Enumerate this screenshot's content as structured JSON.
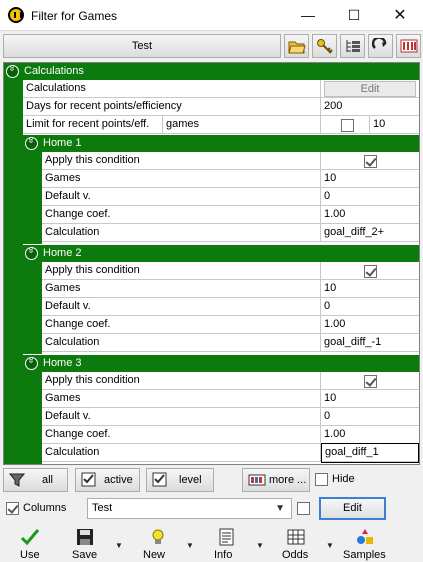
{
  "window": {
    "title": "Filter for Games",
    "minimize": "—",
    "maximize": "☐",
    "close": "✕"
  },
  "toolbar": {
    "preset_label": "Test"
  },
  "grid": {
    "root": {
      "label": "Calculations"
    },
    "rows": [
      {
        "label": "Calculations",
        "value": "Edit"
      },
      {
        "label": "Days for recent points/efficiency",
        "value": "200"
      },
      {
        "label": "Limit for recent points/eff.",
        "mid": "games",
        "value": "10"
      }
    ],
    "sections": [
      {
        "label": "Home 1",
        "apply_label": "Apply this condition",
        "fields": [
          {
            "label": "Games",
            "value": "10"
          },
          {
            "label": "Default v.",
            "value": "0"
          },
          {
            "label": "Change coef.",
            "value": "1.00"
          },
          {
            "label": "Calculation",
            "value": "goal_diff_2+"
          }
        ]
      },
      {
        "label": "Home 2",
        "apply_label": "Apply this condition",
        "fields": [
          {
            "label": "Games",
            "value": "10"
          },
          {
            "label": "Default v.",
            "value": "0"
          },
          {
            "label": "Change coef.",
            "value": "1.00"
          },
          {
            "label": "Calculation",
            "value": "goal_diff_-1"
          }
        ]
      },
      {
        "label": "Home 3",
        "apply_label": "Apply this condition",
        "fields": [
          {
            "label": "Games",
            "value": "10"
          },
          {
            "label": "Default v.",
            "value": "0"
          },
          {
            "label": "Change coef.",
            "value": "1.00"
          },
          {
            "label": "Calculation",
            "value": "goal_diff_1"
          }
        ]
      }
    ]
  },
  "filterbar": {
    "all": "all",
    "active": "active",
    "level": "level",
    "more": "more ...",
    "hide": "Hide"
  },
  "colbar": {
    "columns": "Columns",
    "select_value": "Test",
    "edit": "Edit"
  },
  "bottombar": {
    "use": "Use",
    "save": "Save",
    "new": "New",
    "info": "Info",
    "odds": "Odds",
    "samples": "Samples"
  },
  "colors": {
    "section_green": "#0c7a0c",
    "accent_blue": "#3c7fd4"
  }
}
